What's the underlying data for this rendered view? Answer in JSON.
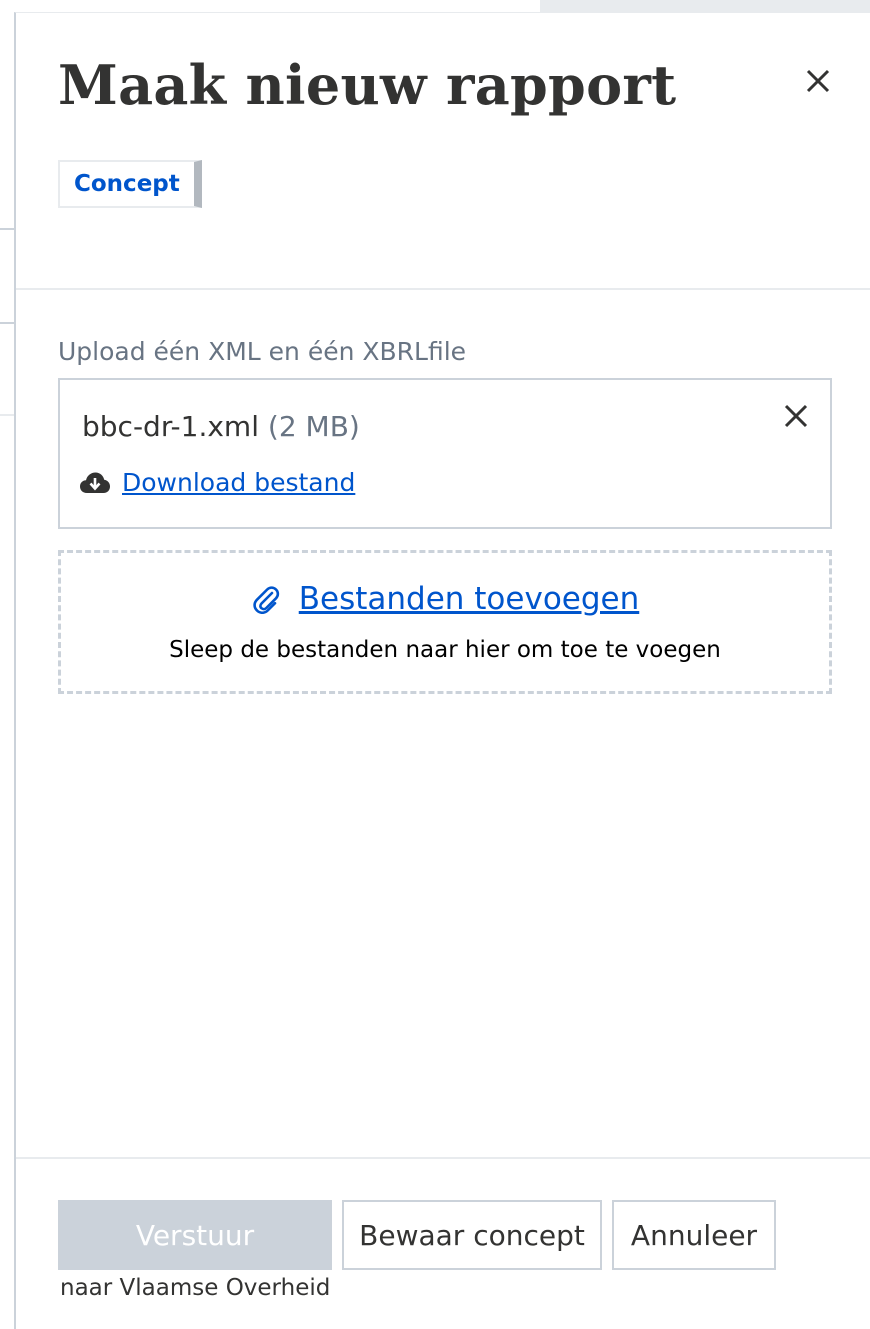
{
  "panel": {
    "title": "Maak nieuw rapport",
    "close_icon": "close-icon",
    "status": "Concept"
  },
  "upload": {
    "label": "Upload één XML en één XBRLfile",
    "file": {
      "name": "bbc-dr-1.xml",
      "size": "(2 MB)",
      "remove_icon": "close-icon",
      "download_icon": "cloud-download-icon",
      "download_label": "Download bestand"
    },
    "dropzone": {
      "icon": "paperclip-icon",
      "add_label": "Bestanden toevoegen",
      "hint": "Sleep de bestanden naar hier om toe te voegen"
    }
  },
  "footer": {
    "send_label": "Verstuur",
    "send_note": "naar Vlaamse Overheid",
    "save_label": "Bewaar concept",
    "cancel_label": "Annuleer"
  },
  "colors": {
    "link": "#0055cc",
    "text": "#333332",
    "muted": "#687483",
    "border": "#cbd2da",
    "disabled_button": "#cbd2da"
  }
}
